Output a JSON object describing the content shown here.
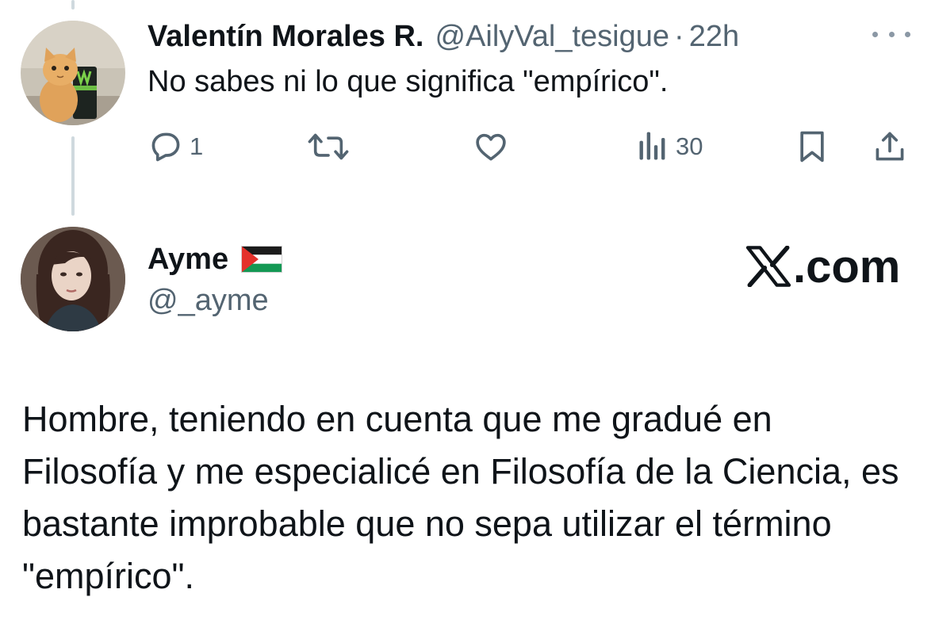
{
  "reply_tweet": {
    "display_name": "Valentín Morales R.",
    "handle": "@AilyVal_tesigue",
    "separator": "·",
    "time": "22h",
    "text": "No sabes ni lo que significa \"empírico\".",
    "actions": {
      "reply_count": "1",
      "repost_count": "",
      "like_count": "",
      "views_count": "30"
    }
  },
  "quoted_tweet": {
    "display_name": "Ayme",
    "flag_icon": "palestine-flag-icon",
    "handle": "@_ayme",
    "text": "Hombre, teniendo en cuenta que me gradué en Filosofía y me especialicé en Filosofía de la Ciencia, es bastante improbable que no sepa utilizar el término \"empírico\"."
  },
  "brand": {
    "logo_icon": "x-logo-icon",
    "suffix": ".com"
  },
  "colors": {
    "text": "#0f1419",
    "secondary": "#536471",
    "thread_line": "#cfd9de"
  }
}
